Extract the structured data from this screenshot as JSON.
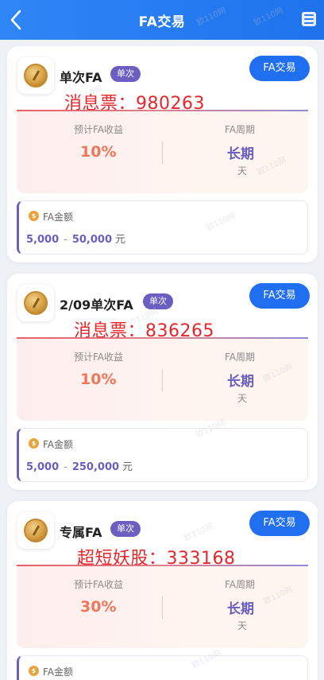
{
  "header": {
    "title": "FA交易"
  },
  "watermark": "欧110网",
  "cards": [
    {
      "name": "单次FA",
      "badge": "单次",
      "button": "FA交易",
      "overlay": "消息票：980263",
      "yield_label": "预计FA收益",
      "yield_value": "10%",
      "period_label": "FA周期",
      "period_value": "长期",
      "period_unit": "天",
      "amount_label": "FA金额",
      "amount_min": "5,000",
      "amount_sep": "-",
      "amount_max": "50,000",
      "amount_unit": "元"
    },
    {
      "name": "2/09单次FA",
      "badge": "单次",
      "button": "FA交易",
      "overlay": "消息票：836265",
      "yield_label": "预计FA收益",
      "yield_value": "10%",
      "period_label": "FA周期",
      "period_value": "长期",
      "period_unit": "天",
      "amount_label": "FA金额",
      "amount_min": "5,000",
      "amount_sep": "-",
      "amount_max": "250,000",
      "amount_unit": "元"
    },
    {
      "name": "专属FA",
      "badge": "单次",
      "button": "FA交易",
      "overlay": "超短妖股：333168",
      "yield_label": "预计FA收益",
      "yield_value": "30%",
      "period_label": "FA周期",
      "period_value": "长期",
      "period_unit": "天",
      "amount_label": "FA金额"
    }
  ],
  "colors": {
    "header": "#2f86f6",
    "button": "#1f6ff0",
    "badge": "#6a5fc1",
    "yield": "#f1765a",
    "overlay": "#e8262a"
  }
}
